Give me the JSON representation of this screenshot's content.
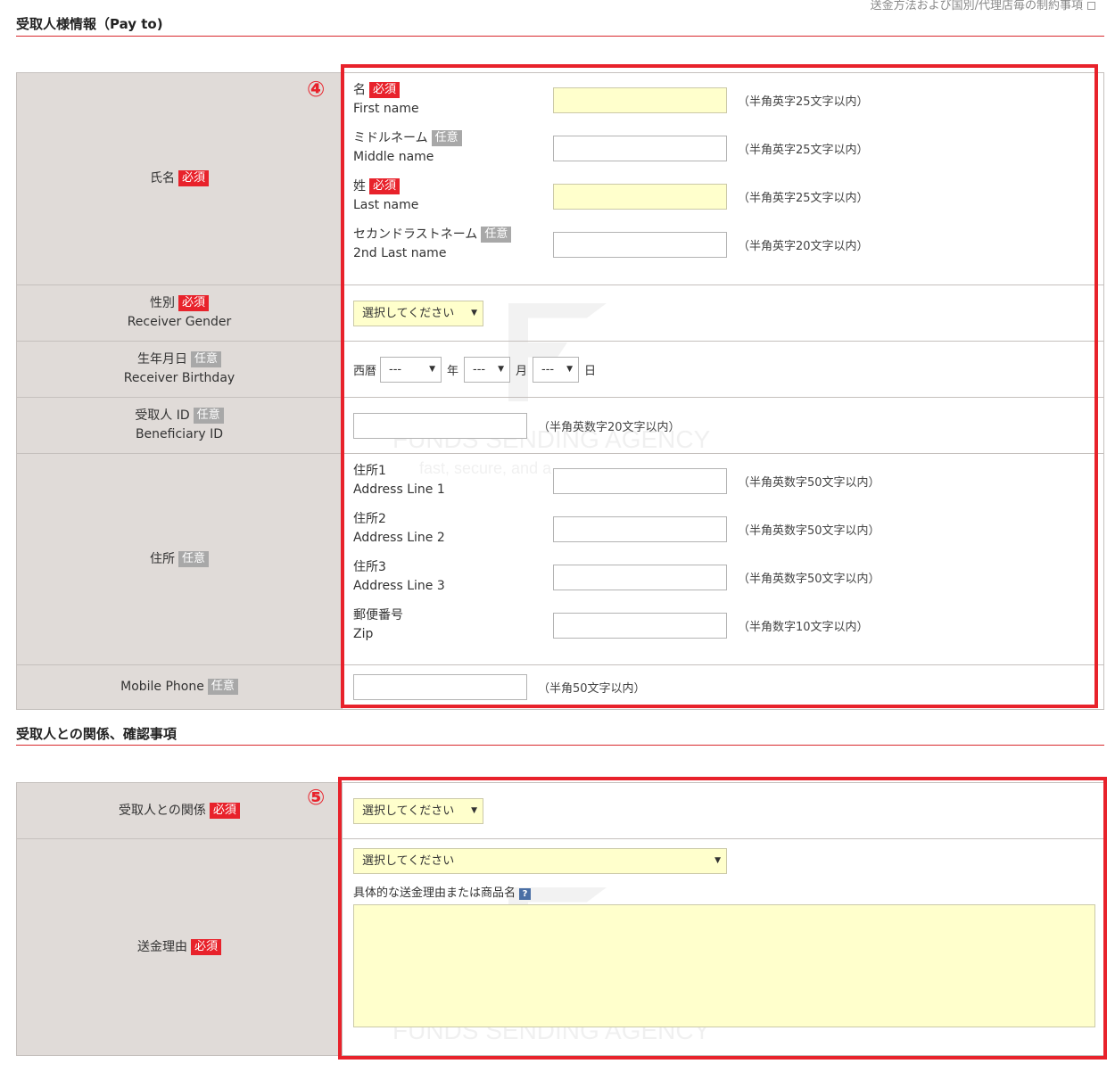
{
  "top_link": "送金方法および国別/代理店毎の制約事項",
  "section1": {
    "title": "受取人様情報（Pay to)",
    "step": "④",
    "name_label": "氏名",
    "required": "必須",
    "optional": "任意",
    "names": [
      {
        "label": "名",
        "sub": "First name",
        "badge": "必須",
        "note": "（半角英字25文字以内）",
        "yellow": true
      },
      {
        "label": "ミドルネーム",
        "sub": "Middle name",
        "badge": "任意",
        "note": "（半角英字25文字以内）",
        "yellow": false
      },
      {
        "label": "姓",
        "sub": "Last name",
        "badge": "必須",
        "note": "（半角英字25文字以内）",
        "yellow": true
      },
      {
        "label": "セカンドラストネーム",
        "sub": "2nd Last name",
        "badge": "任意",
        "note": "（半角英字20文字以内）",
        "yellow": false
      }
    ],
    "gender": {
      "label": "性別",
      "sub": "Receiver Gender",
      "badge": "必須",
      "select": "選択してください"
    },
    "birthday": {
      "label": "生年月日",
      "sub": "Receiver Birthday",
      "badge": "任意",
      "era": "西暦",
      "year_select": "---",
      "year": "年",
      "month_select": "---",
      "month": "月",
      "day_select": "---",
      "day": "日"
    },
    "beneficiary": {
      "label": "受取人 ID",
      "sub": "Beneficiary ID",
      "badge": "任意",
      "note": "（半角英数字20文字以内）"
    },
    "address": {
      "label": "住所",
      "badge": "任意",
      "lines": [
        {
          "label": "住所1",
          "sub": "Address Line 1",
          "note": "（半角英数字50文字以内）"
        },
        {
          "label": "住所2",
          "sub": "Address Line 2",
          "note": "（半角英数字50文字以内）"
        },
        {
          "label": "住所3",
          "sub": "Address Line 3",
          "note": "（半角英数字50文字以内）"
        },
        {
          "label": "郵便番号",
          "sub": "Zip",
          "note": "（半角数字10文字以内）"
        }
      ]
    },
    "mobile": {
      "label": "Mobile Phone",
      "badge": "任意",
      "note": "（半角50文字以内）"
    }
  },
  "section2": {
    "title": "受取人との関係、確認事項",
    "step": "⑤",
    "relation": {
      "label": "受取人との関係",
      "badge": "必須",
      "select": "選択してください"
    },
    "reason": {
      "label": "送金理由",
      "badge": "必須",
      "select": "選択してください",
      "detail_label": "具体的な送金理由または商品名",
      "help": "?"
    }
  },
  "watermark": {
    "brand": "FUNDS SENDING AGENCY",
    "tagline": "fast, secure, and a"
  },
  "colors": {
    "accent": "#e8222b",
    "header_bg": "#e0dbd8",
    "input_yellow": "#ffffcc",
    "optional_badge": "#a8a8a8"
  }
}
